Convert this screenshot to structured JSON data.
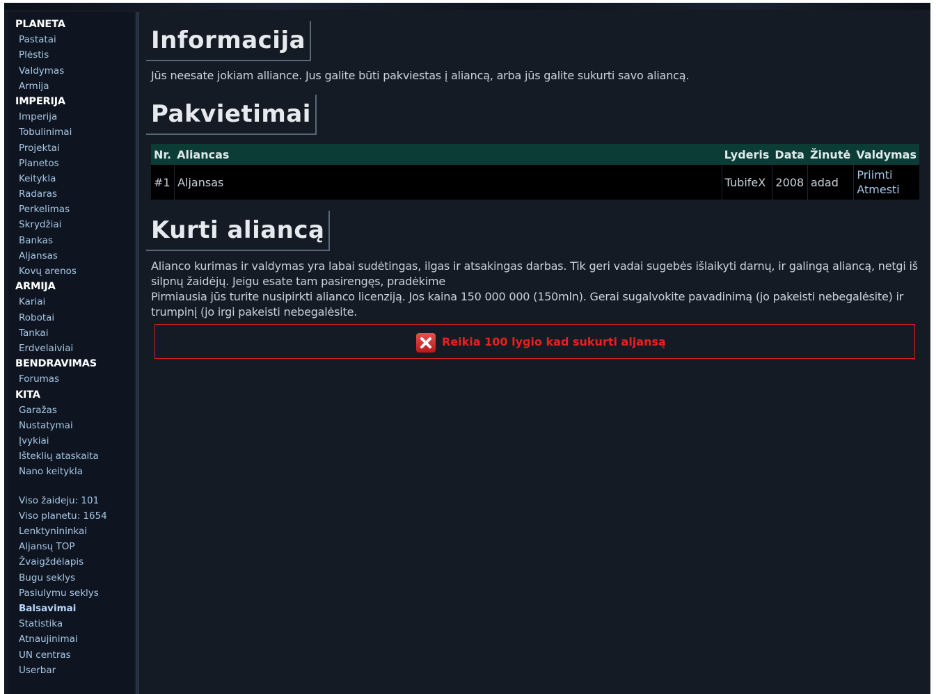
{
  "sidebar": {
    "sections": [
      {
        "title": "PLANETA",
        "items": [
          "Pastatai",
          "Plėstis",
          "Valdymas",
          "Armija"
        ]
      },
      {
        "title": "IMPERIJA",
        "items": [
          "Imperija",
          "Tobulinimai",
          "Projektai",
          "Planetos",
          "Keitykla",
          "Radaras",
          "Perkelimas",
          "Skrydžiai",
          "Bankas",
          "Aljansas",
          "Kovų arenos"
        ]
      },
      {
        "title": "ARMIJA",
        "items": [
          "Kariai",
          "Robotai",
          "Tankai",
          "Erdvelaiviai"
        ]
      },
      {
        "title": "BENDRAVIMAS",
        "items": [
          "Forumas"
        ]
      },
      {
        "title": "KITA",
        "items": [
          "Garažas",
          "Nustatymai",
          "Įvykiai",
          "Išteklių ataskaita",
          "Nano keitykla"
        ]
      }
    ],
    "extra": [
      "Viso žaideju: 101",
      "Viso planetu: 1654",
      "Lenktynininkai",
      "Aljansų TOP",
      "Žvaigždėlapis",
      "Bugu seklys",
      "Pasiulymu seklys",
      "Balsavimai",
      "Statistika",
      "Atnaujinimai",
      "UN centras",
      "Userbar"
    ]
  },
  "info": {
    "heading": "Informacija",
    "text": "Jūs neesate jokiam alliance. Jus galite būti pakviestas į aliancą, arba jūs galite sukurti savo aliancą."
  },
  "invites": {
    "heading": "Pakvietimai",
    "columns": {
      "nr": "Nr.",
      "aliance": "Aliancas",
      "leader": "Lyderis",
      "date": "Data",
      "message": "Žinutė",
      "manage": "Valdymas"
    },
    "row": {
      "nr": "#1",
      "aliance": "Aljansas",
      "leader": "TubifeX",
      "date": "2008",
      "message": "adad",
      "accept": "Priimti",
      "reject": "Atmesti"
    }
  },
  "create": {
    "heading": "Kurti aliancą",
    "text1": "Alianco kurimas ir valdymas yra labai sudėtingas, ilgas ir atsakingas darbas. Tik geri vadai sugebės išlaikyti darnų, ir galingą aliancą, netgi iš silpnų žaidėjų. Jeigu esate tam pasirengęs, pradėkime",
    "text2": "Pirmiausia jūs turite nusipirkti alianco licenziją. Jos kaina 150 000 000 (150mln). Gerai sugalvokite pavadinimą (jo pakeisti nebegalėsite) ir trumpinį (jo irgi pakeisti nebegalėsite.",
    "error": "Reikia 100 lygio kad sukurti aljansą"
  }
}
